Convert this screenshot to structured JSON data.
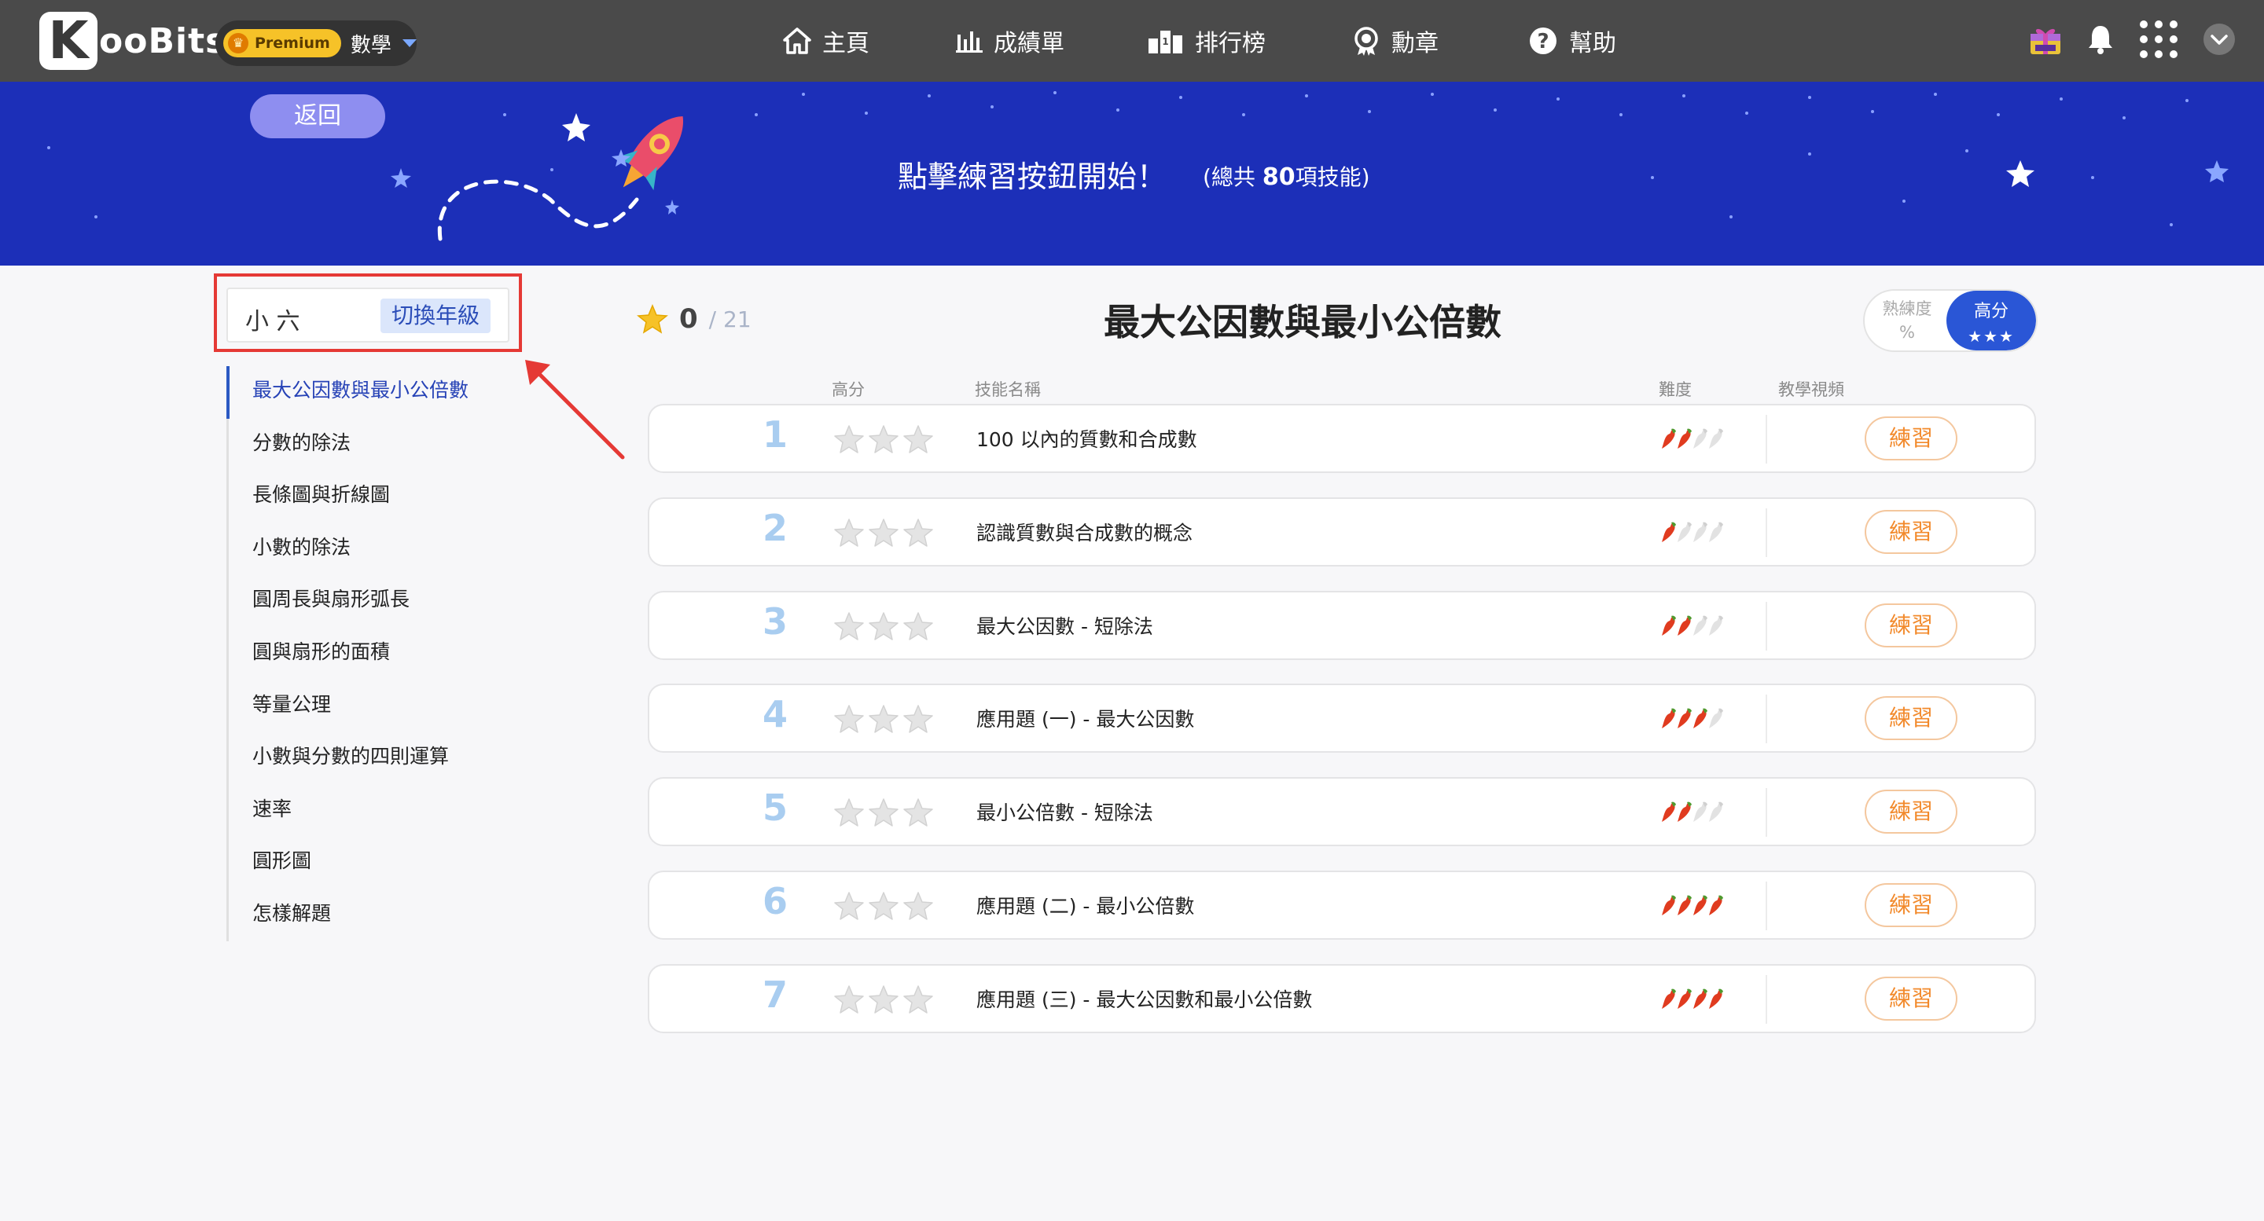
{
  "header": {
    "logo_text": "ooBits",
    "logo_k": "K",
    "premium_label": "Premium",
    "subject": "數學",
    "nav": [
      {
        "label": "主頁",
        "icon": "home-icon"
      },
      {
        "label": "成績單",
        "icon": "bar-chart-icon"
      },
      {
        "label": "排行榜",
        "icon": "leaderboard-icon"
      },
      {
        "label": "勳章",
        "icon": "medal-icon"
      },
      {
        "label": "幫助",
        "icon": "help-icon"
      }
    ]
  },
  "banner": {
    "back_label": "返回",
    "message": "點擊練習按鈕開始！",
    "total_prefix": "(總共 ",
    "total_count": "80",
    "total_suffix": "項技能)"
  },
  "sidebar": {
    "grade": "小 六",
    "switch_label": "切換年級",
    "items": [
      "最大公因數與最小公倍數",
      "分數的除法",
      "長條圖與折線圖",
      "小數的除法",
      "圓周長與扇形弧長",
      "圓與扇形的面積",
      "等量公理",
      "小數與分數的四則運算",
      "速率",
      "圓形圖",
      "怎樣解題"
    ],
    "active_index": 0
  },
  "main": {
    "title": "最大公因數與最小公倍數",
    "score": "0",
    "score_total": "/ 21",
    "toggle_left_line1": "熟練度",
    "toggle_left_line2": "%",
    "toggle_right": "高分",
    "toggle_right_stars": "★★★",
    "columns": {
      "score": "高分",
      "skill": "技能名稱",
      "difficulty": "難度",
      "video": "教學視頻"
    },
    "practice_label": "練習",
    "skills": [
      {
        "num": "1",
        "name": "100 以內的質數和合成數",
        "stars": 0,
        "difficulty": 2
      },
      {
        "num": "2",
        "name": "認識質數與合成數的概念",
        "stars": 0,
        "difficulty": 1
      },
      {
        "num": "3",
        "name": "最大公因數 - 短除法",
        "stars": 0,
        "difficulty": 2
      },
      {
        "num": "4",
        "name": "應用題 (一) - 最大公因數",
        "stars": 0,
        "difficulty": 3
      },
      {
        "num": "5",
        "name": "最小公倍數 - 短除法",
        "stars": 0,
        "difficulty": 2
      },
      {
        "num": "6",
        "name": "應用題 (二) - 最小公倍數",
        "stars": 0,
        "difficulty": 4
      },
      {
        "num": "7",
        "name": "應用題 (三) - 最大公因數和最小公倍數",
        "stars": 0,
        "difficulty": 4
      }
    ]
  },
  "colors": {
    "banner": "#1c2fb8",
    "topbar": "#4a4a4a",
    "accent": "#2a56d6",
    "practice": "#f28a2c",
    "highlight": "#e53935"
  }
}
